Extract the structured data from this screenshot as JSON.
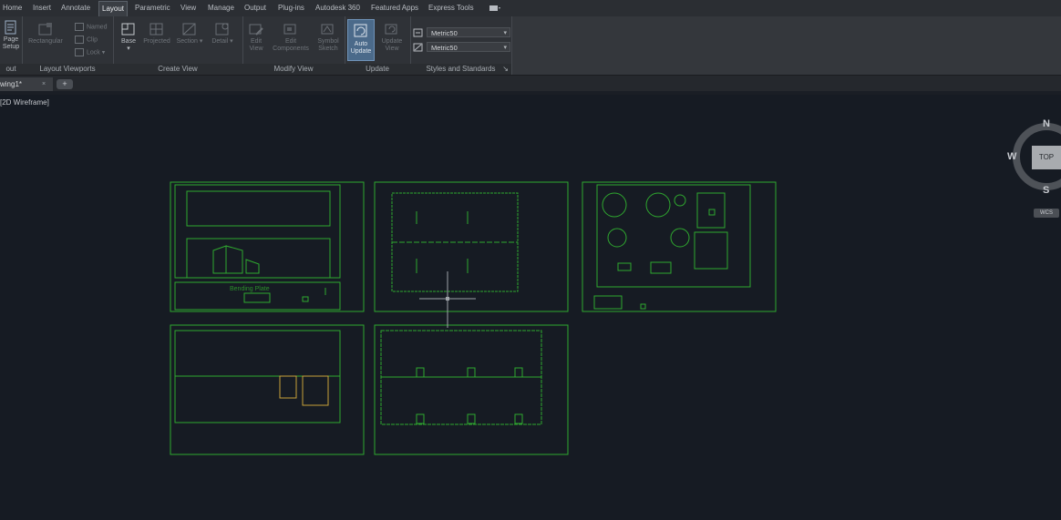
{
  "ribbon": {
    "tabs": [
      "Home",
      "Insert",
      "Annotate",
      "Layout",
      "Parametric",
      "View",
      "Manage",
      "Output",
      "Plug-ins",
      "Autodesk 360",
      "Featured Apps",
      "Express Tools"
    ],
    "active_tab": "Layout",
    "groups": {
      "layout": {
        "label": "out",
        "page_setup": "Page\nSetup"
      },
      "layout_viewports": {
        "label": "Layout Viewports",
        "rectangular": "Rectangular",
        "named": "Named",
        "clip": "Clip",
        "lock": "Lock"
      },
      "create_view": {
        "label": "Create View",
        "base": "Base",
        "projected": "Projected",
        "section": "Section",
        "detail": "Detail"
      },
      "modify_view": {
        "label": "Modify View",
        "edit_view": "Edit\nView",
        "edit_components": "Edit\nComponents",
        "symbol_sketch": "Symbol\nSketch"
      },
      "update": {
        "label": "Update",
        "auto_update": "Auto\nUpdate",
        "update_view": "Update\nView"
      },
      "styles": {
        "label": "Styles and Standards",
        "style1": "Metric50",
        "style2": "Metric50"
      }
    }
  },
  "file_tab": {
    "name": "wing1*",
    "close": "×",
    "new": "+"
  },
  "viewport": {
    "label": "[2D Wireframe]"
  },
  "viewcube": {
    "north": "N",
    "west": "W",
    "south": "S",
    "top": "TOP",
    "wcs": "WCS"
  },
  "drawing_note": "Bending Plate",
  "colors": {
    "background": "#161b23",
    "line": "#2fa82f",
    "ribbon": "#2f3237",
    "accent": "#5b9bd5"
  }
}
